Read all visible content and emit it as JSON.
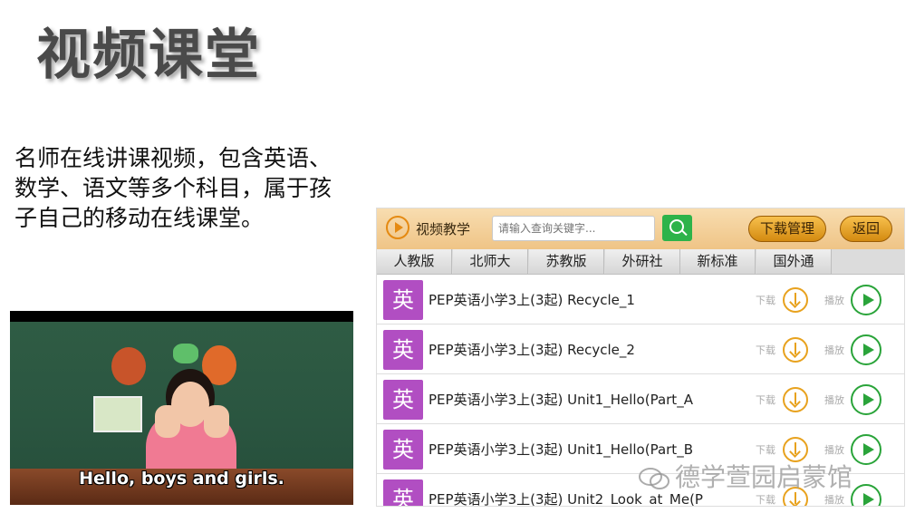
{
  "slide": {
    "title": "视频课堂",
    "description": "名师在线讲课视频，包含英语、数学、语文等多个科目，属于孩子自己的移动在线课堂。"
  },
  "video": {
    "subtitle": "Hello, boys and girls."
  },
  "app": {
    "title": "视频教学",
    "search_placeholder": "请输入查询关键字...",
    "download_manager_label": "下载管理",
    "back_label": "返回",
    "tabs": [
      "人教版",
      "北师大",
      "苏教版",
      "外研社",
      "新标准",
      "国外通"
    ],
    "items": [
      {
        "badge": "英",
        "title": "PEP英语小学3上(3起) Recycle_1",
        "download_label": "下载",
        "play_label": "播放"
      },
      {
        "badge": "英",
        "title": "PEP英语小学3上(3起) Recycle_2",
        "download_label": "下载",
        "play_label": "播放"
      },
      {
        "badge": "英",
        "title": "PEP英语小学3上(3起) Unit1_Hello(Part_A",
        "download_label": "下载",
        "play_label": "播放"
      },
      {
        "badge": "英",
        "title": "PEP英语小学3上(3起) Unit1_Hello(Part_B",
        "download_label": "下载",
        "play_label": "播放"
      },
      {
        "badge": "英",
        "title": "PEP英语小学3上(3起) Unit2_Look_at_Me(P",
        "download_label": "下载",
        "play_label": "播放"
      }
    ],
    "colors": {
      "accent": "#e8a21e",
      "play": "#2aa43a",
      "badge": "#b14ec2",
      "search_button": "#2db34a"
    }
  },
  "watermark": "德学萱园启蒙馆"
}
